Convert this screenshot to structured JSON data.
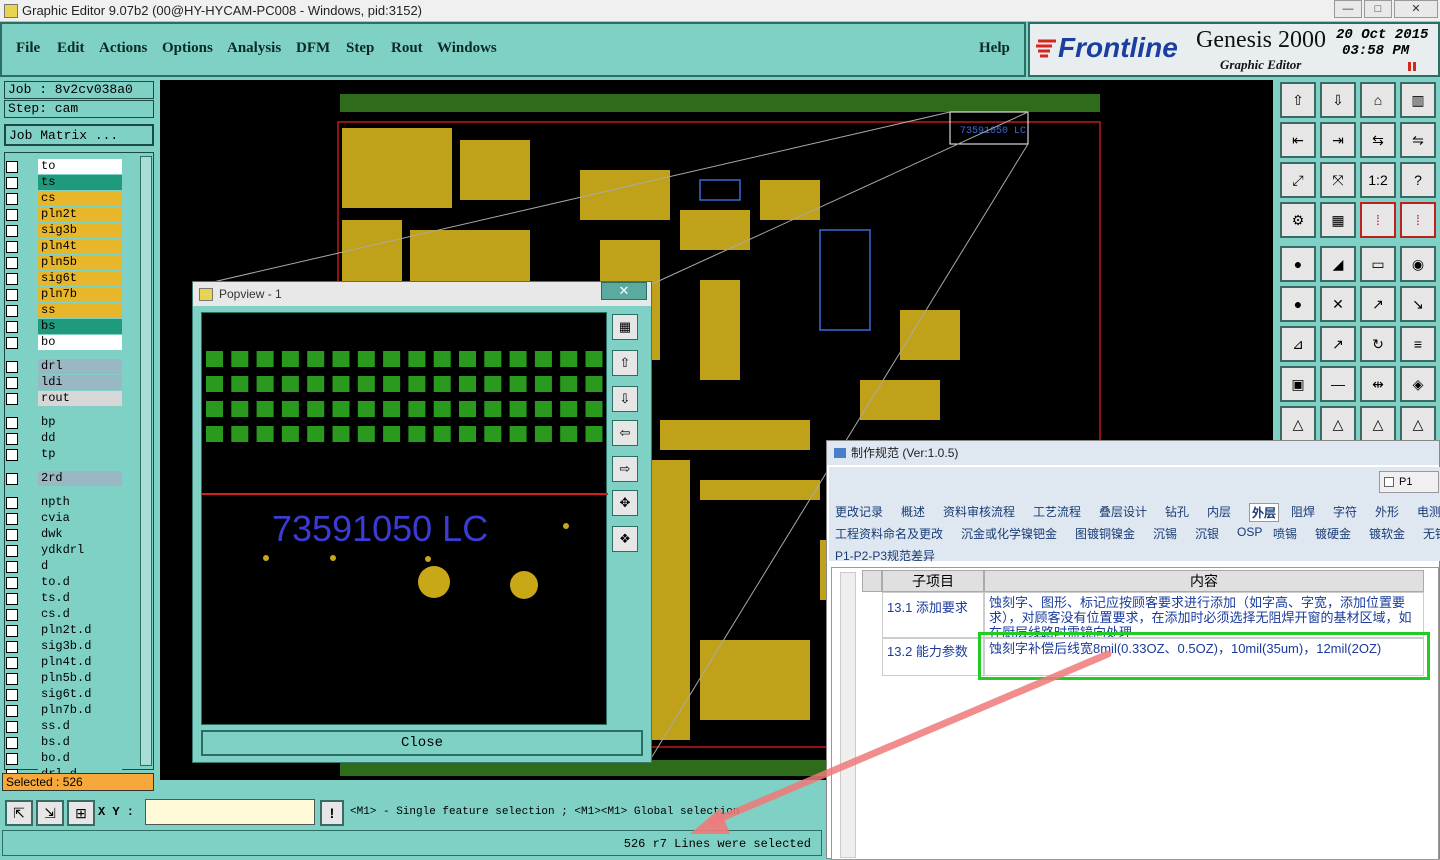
{
  "window": {
    "title": "Graphic Editor 9.07b2 (00@HY-HYCAM-PC008 - Windows, pid:3152)"
  },
  "menu": {
    "items": [
      "File",
      "Edit",
      "Actions",
      "Options",
      "Analysis",
      "DFM",
      "Step",
      "Rout",
      "Windows"
    ],
    "help": "Help"
  },
  "brand": {
    "logo": "Frontline",
    "product": "Genesis 2000",
    "subtitle": "Graphic Editor",
    "date": "20 Oct 2015",
    "time": "03:58 PM"
  },
  "job": {
    "job_label": "Job : 8v2cv038a0",
    "step_label": "Step: cam",
    "matrix_button": "Job Matrix ..."
  },
  "layers": [
    {
      "name": "to",
      "color": "#ffffff"
    },
    {
      "name": "ts",
      "color": "#1f9a7a"
    },
    {
      "name": "cs",
      "color": "#e8b62a"
    },
    {
      "name": "pln2t",
      "color": "#e8b62a"
    },
    {
      "name": "sig3b",
      "color": "#e8b62a"
    },
    {
      "name": "pln4t",
      "color": "#e8b62a"
    },
    {
      "name": "pln5b",
      "color": "#e8b62a"
    },
    {
      "name": "sig6t",
      "color": "#e8b62a"
    },
    {
      "name": "pln7b",
      "color": "#e8b62a"
    },
    {
      "name": "ss",
      "color": "#e8b62a"
    },
    {
      "name": "bs",
      "color": "#1f9a7a"
    },
    {
      "name": "bo",
      "color": "#ffffff"
    },
    {
      "name": "drl",
      "color": "#9ab8c4"
    },
    {
      "name": "ldi",
      "color": "#9ab8c4"
    },
    {
      "name": "rout",
      "color": "#d7d7d7"
    },
    {
      "name": "bp",
      "color": "#7fd1c6"
    },
    {
      "name": "dd",
      "color": "#7fd1c6"
    },
    {
      "name": "tp",
      "color": "#7fd1c6"
    },
    {
      "name": "2rd",
      "color": "#9ab8c4"
    },
    {
      "name": "npth",
      "color": "#7fd1c6"
    },
    {
      "name": "cvia",
      "color": "#7fd1c6"
    },
    {
      "name": "dwk",
      "color": "#7fd1c6"
    },
    {
      "name": "ydkdrl",
      "color": "#7fd1c6"
    },
    {
      "name": "d",
      "color": "#7fd1c6"
    },
    {
      "name": "to.d",
      "color": "#7fd1c6"
    },
    {
      "name": "ts.d",
      "color": "#7fd1c6"
    },
    {
      "name": "cs.d",
      "color": "#7fd1c6"
    },
    {
      "name": "pln2t.d",
      "color": "#7fd1c6"
    },
    {
      "name": "sig3b.d",
      "color": "#7fd1c6"
    },
    {
      "name": "pln4t.d",
      "color": "#7fd1c6"
    },
    {
      "name": "pln5b.d",
      "color": "#7fd1c6"
    },
    {
      "name": "sig6t.d",
      "color": "#7fd1c6"
    },
    {
      "name": "pln7b.d",
      "color": "#7fd1c6"
    },
    {
      "name": "ss.d",
      "color": "#7fd1c6"
    },
    {
      "name": "bs.d",
      "color": "#7fd1c6"
    },
    {
      "name": "bo.d",
      "color": "#7fd1c6"
    },
    {
      "name": "drl.d",
      "color": "#7fd1c6"
    }
  ],
  "status": {
    "selected": "Selected : 526",
    "xy_label": "X Y :",
    "xy_value": "",
    "prompt": "<M1> - Single feature selection ; <M1><M1> Global selection",
    "message": "526 r7 Lines were selected"
  },
  "board": {
    "marking_text": "73591050 LC"
  },
  "popview": {
    "title": "Popview - 1",
    "marking_text": "73591050 LC",
    "close_label": "Close"
  },
  "dialog": {
    "title": "制作规范 (Ver:1.0.5)",
    "p1_label": "P1",
    "tabs_row1": [
      "更改记录",
      "概述",
      "资料审核流程",
      "工艺流程",
      "叠层设计",
      "钻孔",
      "内层",
      "外层",
      "阻焊",
      "字符",
      "外形",
      "电测试"
    ],
    "tabs_row2": [
      "工程资料命名及更改",
      "沉金或化学镍钯金",
      "图镀铜镍金",
      "沉锡",
      "沉银",
      "OSP",
      "喷锡",
      "镀硬金",
      "镀软金",
      "无铅"
    ],
    "tabs_row3": [
      "P1-P2-P3规范差异"
    ],
    "active_tab": "外层",
    "table": {
      "headers": [
        "子项目",
        "内容"
      ],
      "rows": [
        {
          "item": "13.1 添加要求",
          "content": "蚀刻字、图形、标记应按顾客要求进行添加（如字高、字宽，添加位置要求），对顾客没有位置要求，在添加时必须选择无阻焊开窗的基材区域，如在厨层线路时需镜向处理"
        },
        {
          "item": "13.2 能力参数",
          "content": "蚀刻字补偿后线宽8mil(0.33OZ、0.5OZ)，10mil(35um)，12mil(2OZ)"
        }
      ]
    }
  },
  "colors": {
    "panel": "#7fd1c6",
    "copper": "#bfa11a",
    "pad": "#2a9a1f",
    "highlight": "#22cc22",
    "arrow": "#f07a7a",
    "marking": "#3b3bd6"
  }
}
